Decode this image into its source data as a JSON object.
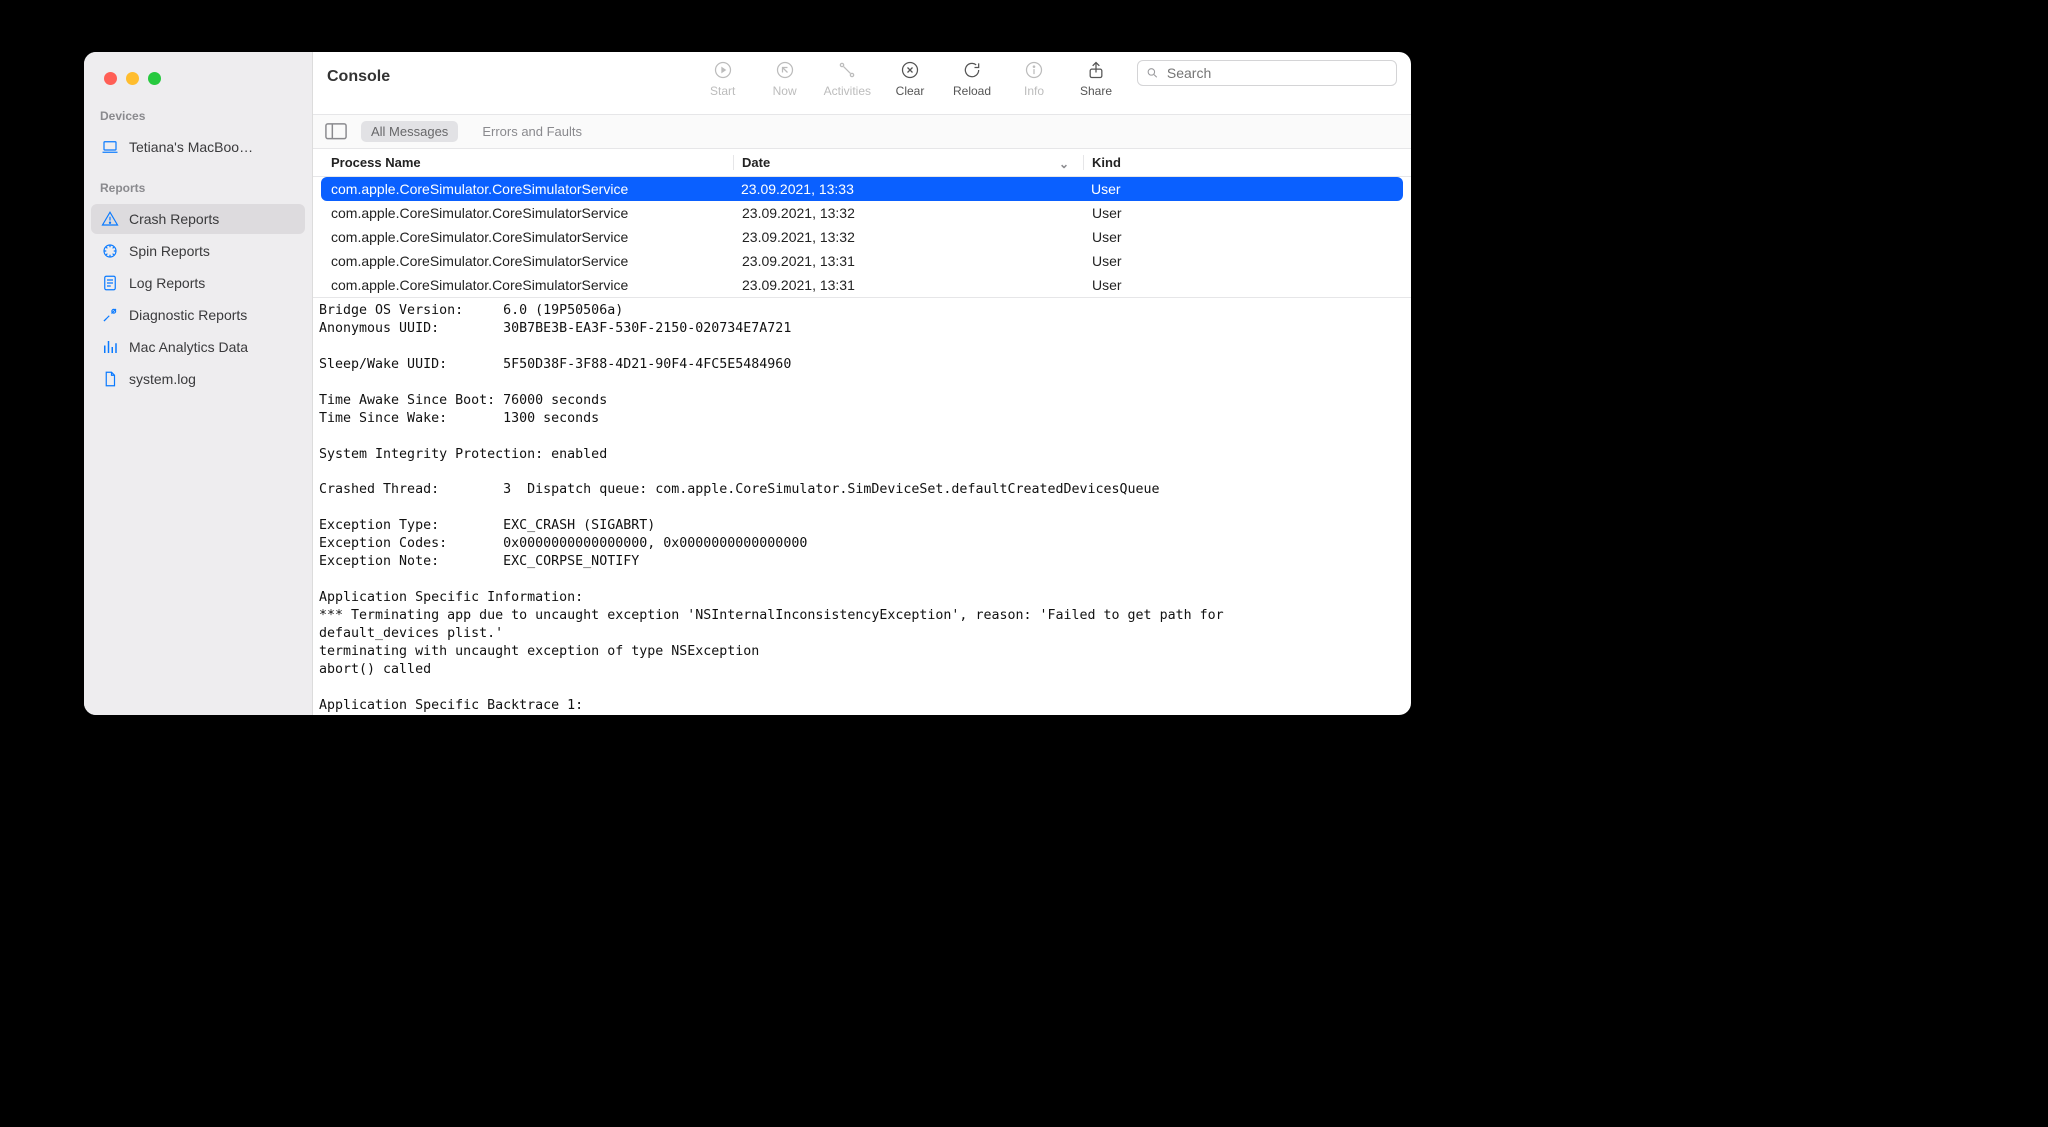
{
  "app_title": "Console",
  "traffic_lights": [
    "close",
    "minimize",
    "zoom"
  ],
  "toolbar": {
    "start": {
      "label": "Start",
      "enabled": false
    },
    "now": {
      "label": "Now",
      "enabled": false
    },
    "activities": {
      "label": "Activities",
      "enabled": false
    },
    "clear": {
      "label": "Clear",
      "enabled": true
    },
    "reload": {
      "label": "Reload",
      "enabled": true
    },
    "info": {
      "label": "Info",
      "enabled": false
    },
    "share": {
      "label": "Share",
      "enabled": true
    }
  },
  "search": {
    "placeholder": "Search"
  },
  "filter_bar": {
    "all_messages": "All Messages",
    "errors_faults": "Errors and Faults"
  },
  "sidebar": {
    "devices_label": "Devices",
    "device_name": "Tetiana's MacBoo…",
    "reports_label": "Reports",
    "items": [
      {
        "label": "Crash Reports",
        "icon": "warning",
        "selected": true
      },
      {
        "label": "Spin Reports",
        "icon": "spin",
        "selected": false
      },
      {
        "label": "Log Reports",
        "icon": "log",
        "selected": false
      },
      {
        "label": "Diagnostic Reports",
        "icon": "diag",
        "selected": false
      },
      {
        "label": "Mac Analytics Data",
        "icon": "analytics",
        "selected": false
      },
      {
        "label": "system.log",
        "icon": "file",
        "selected": false
      }
    ]
  },
  "columns": {
    "process": "Process Name",
    "date": "Date",
    "kind": "Kind"
  },
  "rows": [
    {
      "process": "com.apple.CoreSimulator.CoreSimulatorService",
      "date": "23.09.2021, 13:33",
      "kind": "User",
      "selected": true
    },
    {
      "process": "com.apple.CoreSimulator.CoreSimulatorService",
      "date": "23.09.2021, 13:32",
      "kind": "User",
      "selected": false
    },
    {
      "process": "com.apple.CoreSimulator.CoreSimulatorService",
      "date": "23.09.2021, 13:32",
      "kind": "User",
      "selected": false
    },
    {
      "process": "com.apple.CoreSimulator.CoreSimulatorService",
      "date": "23.09.2021, 13:31",
      "kind": "User",
      "selected": false
    },
    {
      "process": "com.apple.CoreSimulator.CoreSimulatorService",
      "date": "23.09.2021, 13:31",
      "kind": "User",
      "selected": false
    }
  ],
  "detail_text": "Bridge OS Version:     6.0 (19P50506a)\nAnonymous UUID:        30B7BE3B-EA3F-530F-2150-020734E7A721\n\nSleep/Wake UUID:       5F50D38F-3F88-4D21-90F4-4FC5E5484960\n\nTime Awake Since Boot: 76000 seconds\nTime Since Wake:       1300 seconds\n\nSystem Integrity Protection: enabled\n\nCrashed Thread:        3  Dispatch queue: com.apple.CoreSimulator.SimDeviceSet.defaultCreatedDevicesQueue\n\nException Type:        EXC_CRASH (SIGABRT)\nException Codes:       0x0000000000000000, 0x0000000000000000\nException Note:        EXC_CORPSE_NOTIFY\n\nApplication Specific Information:\n*** Terminating app due to uncaught exception 'NSInternalInconsistencyException', reason: 'Failed to get path for\ndefault_devices plist.'\nterminating with uncaught exception of type NSException\nabort() called\n\nApplication Specific Backtrace 1:"
}
